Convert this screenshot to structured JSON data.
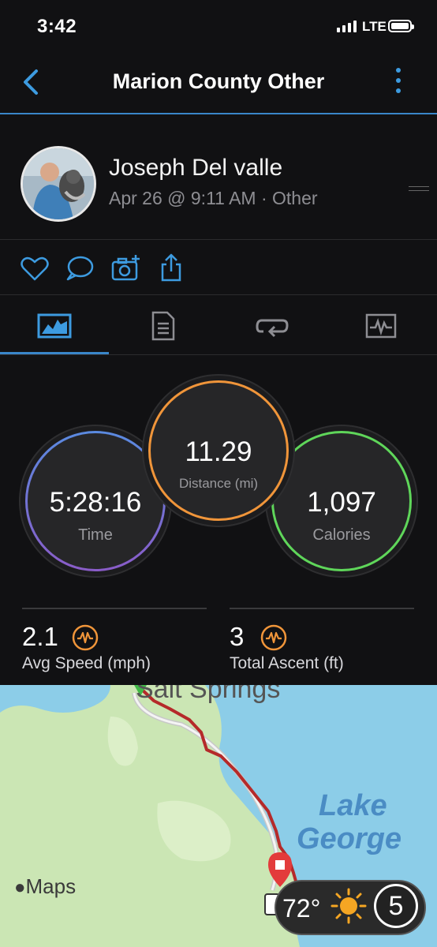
{
  "status_bar": {
    "time": "3:42",
    "network": "LTE"
  },
  "nav": {
    "title": "Marion County Other"
  },
  "activity": {
    "user_name": "Joseph Del valle",
    "meta": "Apr 26 @ 9:11 AM · Other"
  },
  "actions": [
    "heart-icon",
    "comment-icon",
    "add-photo-icon",
    "share-icon"
  ],
  "tabs": [
    "overview-tab",
    "details-tab",
    "laps-tab",
    "charts-tab"
  ],
  "stats": {
    "time": {
      "value": "5:28:16",
      "label": "Time"
    },
    "distance": {
      "value": "11.29",
      "label": "Distance (mi)"
    },
    "calories": {
      "value": "1,097",
      "label": "Calories"
    }
  },
  "metrics": {
    "avg_speed": {
      "value": "2.1",
      "label": "Avg Speed (mph)"
    },
    "total_ascent": {
      "value": "3",
      "label": "Total Ascent (ft)"
    }
  },
  "map": {
    "place_label": "Salt Springs",
    "lake_label_line1": "Lake",
    "lake_label_line2": "George",
    "attribution": "Maps",
    "temperature": "72°",
    "aqi": "5"
  },
  "colors": {
    "accent": "#3a86c9",
    "time_ring": "#6f6fd8",
    "distance_ring": "#f0953a",
    "calories_ring": "#5fd65a",
    "route": "#b52a2a"
  }
}
